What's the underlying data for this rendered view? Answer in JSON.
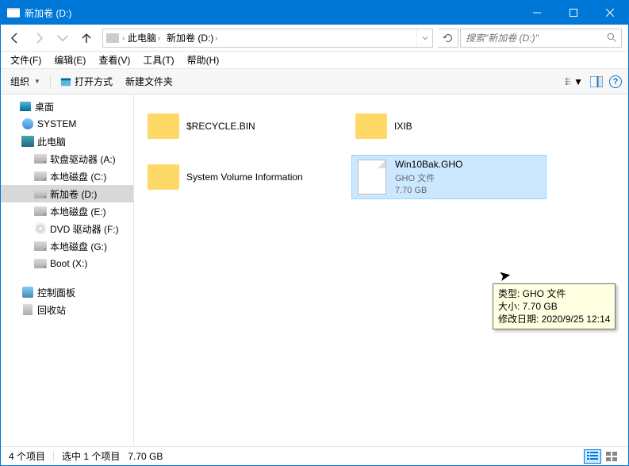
{
  "window": {
    "title": "新加卷 (D:)"
  },
  "breadcrumb": {
    "part1": "此电脑",
    "part2": "新加卷 (D:)"
  },
  "search": {
    "placeholder": "搜索\"新加卷 (D:)\""
  },
  "menubar": {
    "file": "文件(F)",
    "edit": "编辑(E)",
    "view": "查看(V)",
    "tools": "工具(T)",
    "help": "帮助(H)"
  },
  "toolbar": {
    "org": "组织",
    "open": "打开方式",
    "newfolder": "新建文件夹",
    "help": "?"
  },
  "sidebar": {
    "desktop": "桌面",
    "system": "SYSTEM",
    "pc": "此电脑",
    "floppy": "软盘驱动器 (A:)",
    "c": "本地磁盘 (C:)",
    "d": "新加卷 (D:)",
    "e": "本地磁盘 (E:)",
    "dvd": "DVD 驱动器 (F:)",
    "g": "本地磁盘 (G:)",
    "x": "Boot (X:)",
    "cp": "控制面板",
    "rb": "回收站"
  },
  "files": {
    "recycle": "$RECYCLE.BIN",
    "ixib": "IXIB",
    "svi": "System Volume Information",
    "gho": {
      "name": "Win10Bak.GHO",
      "type": "GHO 文件",
      "size": "7.70 GB"
    }
  },
  "tooltip": {
    "l1": "类型: GHO 文件",
    "l2": "大小: 7.70 GB",
    "l3": "修改日期: 2020/9/25 12:14"
  },
  "status": {
    "count": "4 个项目",
    "sel": "选中 1 个项目",
    "size": "7.70 GB"
  }
}
